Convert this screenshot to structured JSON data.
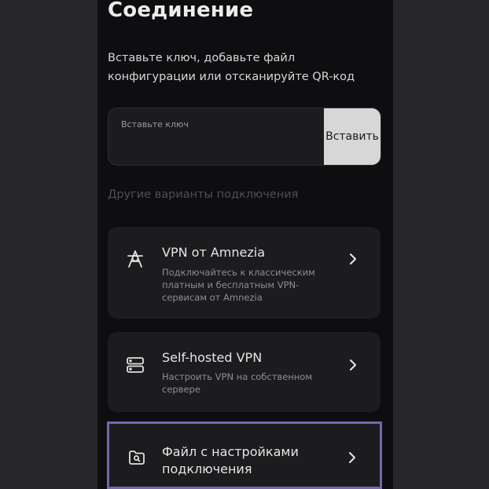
{
  "page": {
    "title": "Соединение",
    "subtitle": "Вставьте ключ, добавьте файл конфигурации или отсканируйте QR-код"
  },
  "key_input": {
    "placeholder": "Вставьте ключ",
    "paste_label": "Вставить"
  },
  "other_options": {
    "label": "Другие варианты подключения",
    "items": [
      {
        "title": "VPN от Amnezia",
        "description": "Подключайтесь к классическим платным и бесплатным VPN-сервисам от Amnezia",
        "icon": "amnezia-logo-icon"
      },
      {
        "title": "Self-hosted VPN",
        "description": "Настроить VPN на собственном сервере",
        "icon": "server-icon"
      },
      {
        "title": "Файл с настройками подключения",
        "description": "",
        "icon": "folder-search-icon"
      }
    ]
  },
  "colors": {
    "background": "#27272a",
    "panel": "#0e0e11",
    "card": "#1c1c1f",
    "focus_ring": "#7766aa"
  }
}
